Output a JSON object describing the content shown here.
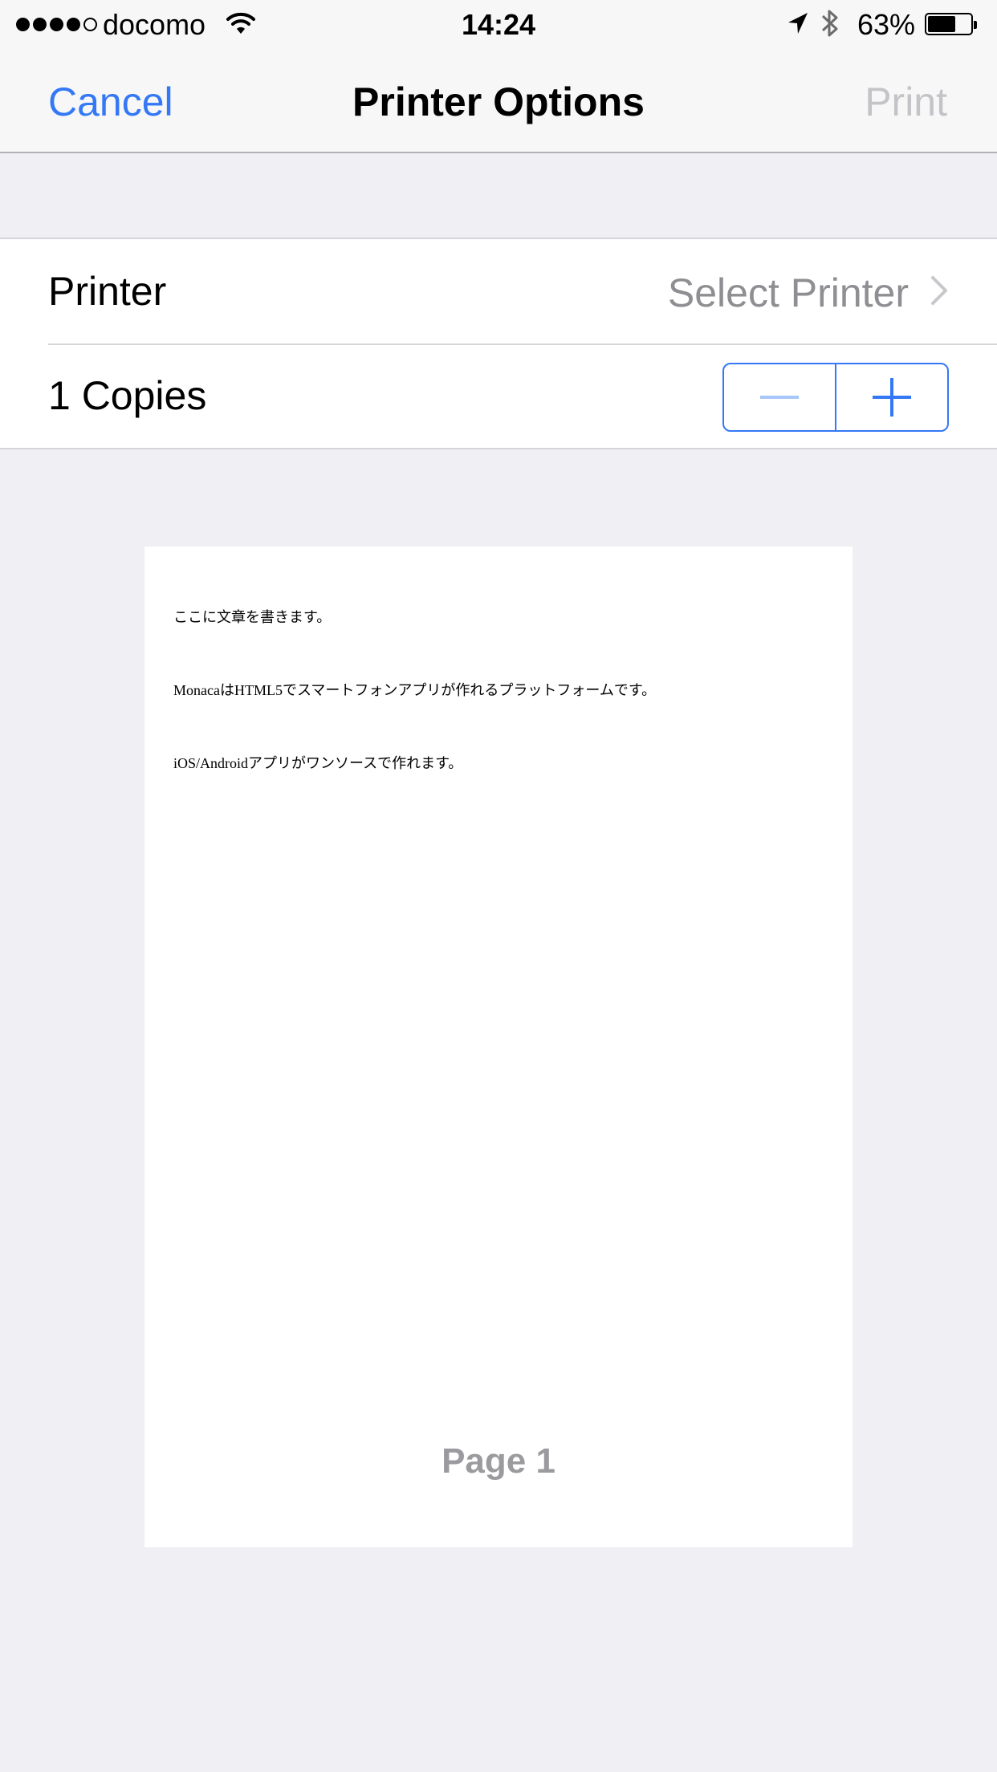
{
  "status_bar": {
    "carrier": "docomo",
    "time": "14:24",
    "battery_percent": "63%",
    "battery_level": 0.63,
    "signal_bars_filled": 4,
    "signal_bars_total": 5
  },
  "nav": {
    "cancel_label": "Cancel",
    "title": "Printer Options",
    "print_label": "Print"
  },
  "printer_row": {
    "label": "Printer",
    "value": "Select Printer"
  },
  "copies_row": {
    "label": "1 Copies"
  },
  "preview": {
    "lines": [
      "ここに文章を書きます。",
      "MonacaはHTML5でスマートフォンアプリが作れるプラットフォームです。",
      "iOS/Androidアプリがワンソースで作れます。"
    ],
    "page_label": "Page 1"
  },
  "colors": {
    "accent": "#3478f6",
    "disabled": "#c4c4c8",
    "secondary_text": "#8e8e93",
    "background": "#efeff4"
  }
}
